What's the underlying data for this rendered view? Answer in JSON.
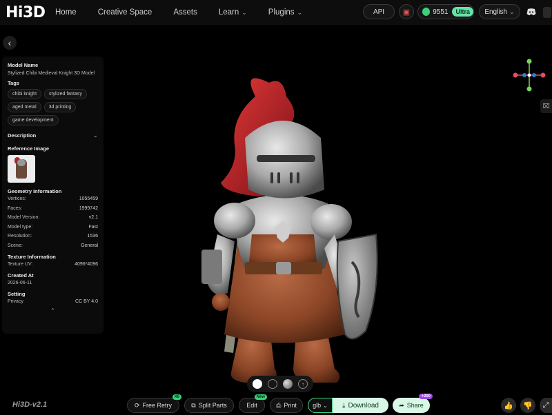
{
  "brand": {
    "logo": "Hi3D"
  },
  "nav": {
    "home": "Home",
    "creative_space": "Creative Space",
    "assets": "Assets",
    "learn": "Learn",
    "plugins": "Plugins"
  },
  "header_right": {
    "api": "API",
    "credits": "9551",
    "plan": "Ultra",
    "language": "English"
  },
  "panel": {
    "model_name_title": "Model Name",
    "model_name": "Stylized Chibi Medieval Knight 3D Model",
    "tags_title": "Tags",
    "tags": [
      "chibi knight",
      "stylized fantasy",
      "aged metal",
      "3d printing",
      "game development"
    ],
    "description_title": "Description",
    "reference_title": "Reference Image",
    "geometry_title": "Geometry Information",
    "geometry": [
      {
        "label": "Vertices:",
        "value": "1055459"
      },
      {
        "label": "Faces:",
        "value": "1999742"
      },
      {
        "label": "Model Version:",
        "value": "v2.1"
      },
      {
        "label": "Model type:",
        "value": "Fast"
      },
      {
        "label": "Resolution:",
        "value": "1536"
      },
      {
        "label": "Scene:",
        "value": "General"
      }
    ],
    "texture_title": "Texture Information",
    "texture": {
      "label": "Texture UV:",
      "value": "4096*4096"
    },
    "created_title": "Created At",
    "created": "2026-06-11",
    "setting_title": "Setting",
    "privacy": {
      "label": "Privacy",
      "value": "CC BY 4.0"
    }
  },
  "bottom": {
    "version": "Hi3D-v2.1",
    "free_retry": "Free Retry",
    "free_retry_badge": "X6",
    "split_parts": "Split Parts",
    "edit": "Edit",
    "edit_badge": "New",
    "print": "Print",
    "format": "glb",
    "download": "Download",
    "share": "Share",
    "share_badge": "+200"
  },
  "colors": {
    "accent_green": "#3bd17a",
    "light_green": "#d9f7e6",
    "plume_red": "#b3202a",
    "badge_purple": "#a046e8"
  }
}
